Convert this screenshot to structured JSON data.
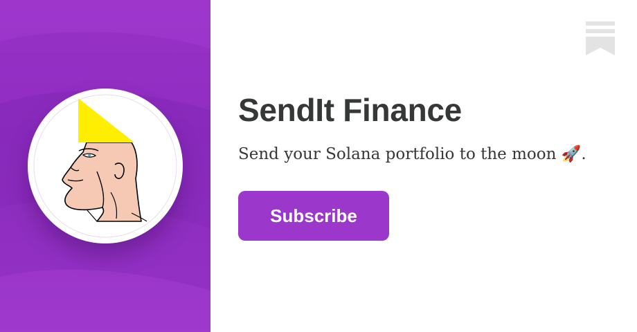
{
  "publication": {
    "name": "SendIt Finance",
    "tagline": "Send your Solana portfolio to the moon 🚀."
  },
  "subscribe": {
    "label": "Subscribe"
  },
  "logo": {
    "icon": "chad-profile-with-yellow-hat-icon"
  },
  "header": {
    "icon": "bookmark-icon"
  },
  "colors": {
    "brand": "#9b37cb",
    "panel": "#8e2fc0",
    "text": "#363737",
    "hat": "#ffee00",
    "skin": "#f5c9b3",
    "icon_gray": "#e3e3e3"
  }
}
